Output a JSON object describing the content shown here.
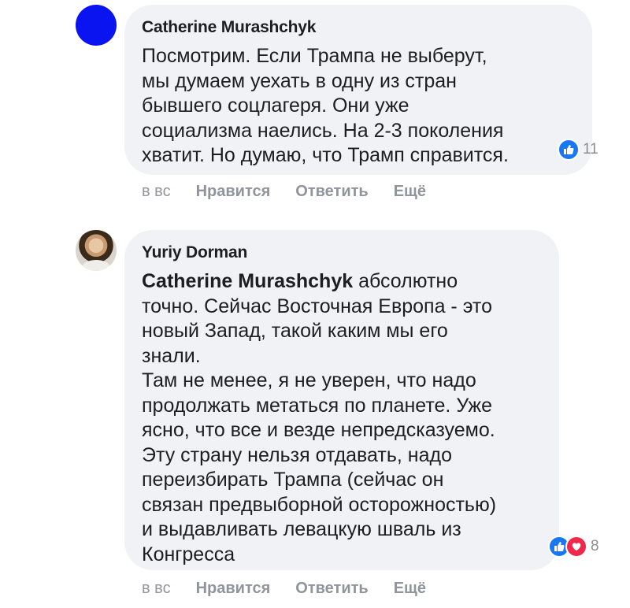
{
  "comments": [
    {
      "author": "Catherine Murashchyk",
      "text": "Посмотрим. Если Трампа не выберут,\nмы думаем уехать в одну из стран\nбывшего соцлагеря. Они уже\nсоциализма наелись. На 2-3 поколения\nхватит. Но думаю, что Трамп справится.",
      "reaction_count": "11",
      "time": "в вс",
      "like_label": "Нравится",
      "reply_label": "Ответить",
      "more_label": "Ещё"
    },
    {
      "author": "Yuriy Dorman",
      "mention": "Catherine Murashchyk",
      "text": " абсолютно\nточно. Сейчас Восточная Европа - это\nновый Запад, такой каким мы его\nзнали.\nТам не менее, я не уверен, что надо\nпродолжать метаться по планете. Уже\nясно, что все и везде непредсказуемо.\nЭту страну нельзя отдавать, надо\nпереизбирать Трампа (сейчас он\nсвязан предвыборной осторожностью)\nи выдавливать левацкую шваль из\nКонгресса",
      "reaction_count": "8",
      "time": "в вс",
      "like_label": "Нравится",
      "reply_label": "Ответить",
      "more_label": "Ещё"
    }
  ],
  "colors": {
    "bubble": "#f0f2f5",
    "like": "#1877f2",
    "love": "#f0284a",
    "meta": "#90949c"
  }
}
